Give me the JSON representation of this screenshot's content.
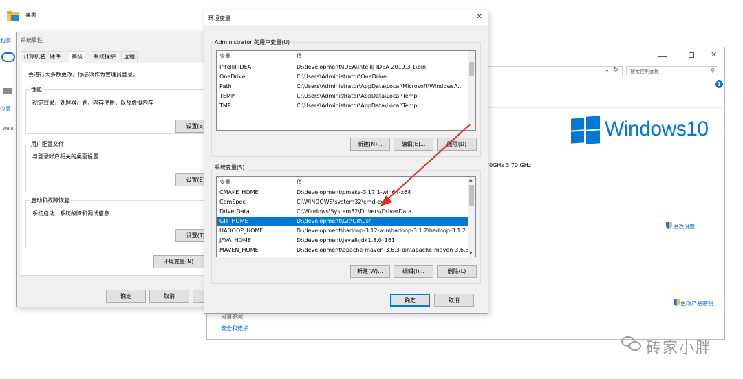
{
  "desktop": {
    "icon_label": "桌面",
    "left_labels": [
      "和驱",
      "位置",
      "Wind"
    ]
  },
  "control_panel": {
    "search_placeholder": "搜索控制面板",
    "windows_logo_text": "Windows10",
    "cpu_text": "70GHz   3.70 GHz",
    "change_settings": "更改设置",
    "change_product_key": "更改产品密钥",
    "see_also": "另请参阅",
    "security_maintenance": "安全和维护"
  },
  "sys_props": {
    "title": "系统属性",
    "tabs": [
      "计算机名",
      "硬件",
      "高级",
      "系统保护",
      "远程"
    ],
    "admin_note": "要进行大多数更改，你必须作为管理员登录。",
    "performance": {
      "title": "性能",
      "desc": "视觉效果，处理器计划，内存使用，以及虚拟内存",
      "button": "设置(S)..."
    },
    "user_profiles": {
      "title": "用户配置文件",
      "desc": "与登录帐户相关的桌面设置",
      "button": "设置(E)..."
    },
    "startup": {
      "title": "启动和故障恢复",
      "desc": "系统启动、系统故障和调试信息",
      "button": "设置(T)..."
    },
    "env_button": "环境变量(N)...",
    "ok": "确定",
    "cancel": "取消"
  },
  "env_dialog": {
    "title": "环境变量",
    "close": "✕",
    "user_section_label": "Administrator 的用户变量(U)",
    "col_var": "变量",
    "col_val": "值",
    "user_vars": [
      {
        "name": "IntelliJ IDEA",
        "value": "D:\\development\\IDEA\\IntelliJ IDEA 2019.3.1\\bin;"
      },
      {
        "name": "OneDrive",
        "value": "C:\\Users\\Administrator\\OneDrive"
      },
      {
        "name": "Path",
        "value": "C:\\Users\\Administrator\\AppData\\Local\\Microsoft\\WindowsA..."
      },
      {
        "name": "TEMP",
        "value": "C:\\Users\\Administrator\\AppData\\Local\\Temp"
      },
      {
        "name": "TMP",
        "value": "C:\\Users\\Administrator\\AppData\\Local\\Temp"
      }
    ],
    "user_buttons": {
      "new": "新建(N)...",
      "edit": "编辑(E)...",
      "delete": "删除(D)"
    },
    "sys_section_label": "系统变量(S)",
    "sys_vars": [
      {
        "name": "CMAKE_HOME",
        "value": "D:\\development\\cmake-3.17.1-win64-x64"
      },
      {
        "name": "ComSpec",
        "value": "C:\\WINDOWS\\system32\\cmd.exe"
      },
      {
        "name": "DriverData",
        "value": "C:\\Windows\\System32\\Drivers\\DriverData"
      },
      {
        "name": "GIT_HOME",
        "value": "D:\\development\\Git\\Git\\usr"
      },
      {
        "name": "HADOOP_HOME",
        "value": "D:\\development\\hadoop-3.12-win\\hadoop-3.1.2\\hadoop-3.1.2"
      },
      {
        "name": "JAVA_HOME",
        "value": "D:\\development\\java8\\jdk1.8.0_161"
      },
      {
        "name": "MAVEN_HOME",
        "value": "D:\\development\\apache-maven-3.6.3-bin\\apache-maven-3.6.3"
      }
    ],
    "selected_sys_var": "GIT_HOME",
    "sys_buttons": {
      "new": "新建(W)...",
      "edit": "编辑(I)...",
      "delete": "删除(L)"
    },
    "ok": "确定",
    "cancel": "取消"
  },
  "watermark": "砖家小胖",
  "colors": {
    "selection": "#0078d7",
    "arrow": "#e8281e",
    "windows_blue": "#0078d7"
  }
}
